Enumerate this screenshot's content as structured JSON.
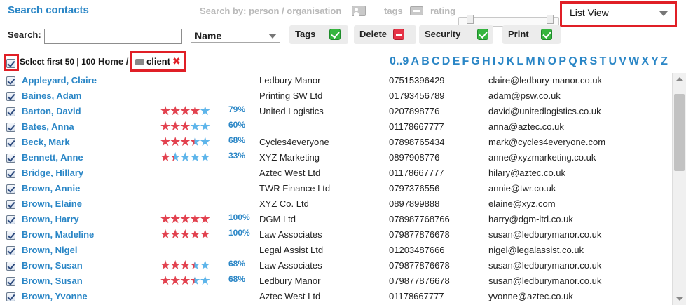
{
  "header": {
    "title": "Search contacts",
    "search_by": "Search by: person / organisation",
    "tags_label": "tags",
    "rating_label": "rating",
    "view_select": "List View"
  },
  "toolbar": {
    "search_label": "Search:",
    "search_value": "",
    "field_select": "Name",
    "tags_label": "Tags",
    "delete_label": "Delete",
    "security_label": "Security",
    "print_label": "Print"
  },
  "selection": {
    "select_first": "Select first 50 | 100",
    "home": "Home /",
    "tag": "client"
  },
  "alphabet": [
    "0..9",
    "A",
    "B",
    "C",
    "D",
    "E",
    "F",
    "G",
    "H",
    "I",
    "J",
    "K",
    "L",
    "M",
    "N",
    "O",
    "P",
    "Q",
    "R",
    "S",
    "T",
    "U",
    "V",
    "W",
    "X",
    "Y",
    "Z"
  ],
  "contacts": [
    {
      "name": "Appleyard, Claire",
      "rating": null,
      "pct": "",
      "company": "Ledbury Manor",
      "phone": "07515396429",
      "email": "claire@ledbury-manor.co.uk"
    },
    {
      "name": "Baines, Adam",
      "rating": null,
      "pct": "",
      "company": "Printing SW Ltd",
      "phone": "01793456789",
      "email": "adam@psw.co.uk"
    },
    {
      "name": "Barton, David",
      "rating": 4,
      "pct": "79%",
      "company": "United Logistics",
      "phone": "0207898776",
      "email": "david@unitedlogistics.co.uk"
    },
    {
      "name": "Bates, Anna",
      "rating": 3,
      "pct": "60%",
      "company": "",
      "phone": "01178667777",
      "email": "anna@aztec.co.uk"
    },
    {
      "name": "Beck, Mark",
      "rating": 3.5,
      "pct": "68%",
      "company": "Cycles4everyone",
      "phone": "07898765434",
      "email": "mark@cycles4everyone.com"
    },
    {
      "name": "Bennett, Anne",
      "rating": 1.5,
      "pct": "33%",
      "company": "XYZ Marketing",
      "phone": "0897908776",
      "email": "anne@xyzmarketing.co.uk"
    },
    {
      "name": "Bridge, Hillary",
      "rating": null,
      "pct": "",
      "company": "Aztec West Ltd",
      "phone": "01178667777",
      "email": "hilary@aztec.co.uk"
    },
    {
      "name": "Brown, Annie",
      "rating": null,
      "pct": "",
      "company": "TWR Finance Ltd",
      "phone": "0797376556",
      "email": "annie@twr.co.uk"
    },
    {
      "name": "Brown, Elaine",
      "rating": null,
      "pct": "",
      "company": "XYZ Co. Ltd",
      "phone": "0897899888",
      "email": "elaine@xyz.com"
    },
    {
      "name": "Brown, Harry",
      "rating": 5,
      "pct": "100%",
      "company": "DGM Ltd",
      "phone": "078987768766",
      "email": "harry@dgm-ltd.co.uk"
    },
    {
      "name": "Brown, Madeline",
      "rating": 5,
      "pct": "100%",
      "company": "Law Associates",
      "phone": "079877876678",
      "email": "susan@ledburymanor.co.uk"
    },
    {
      "name": "Brown, Nigel",
      "rating": null,
      "pct": "",
      "company": "Legal Assist Ltd",
      "phone": "01203487666",
      "email": "nigel@legalassist.co.uk"
    },
    {
      "name": "Brown, Susan",
      "rating": 3.5,
      "pct": "68%",
      "company": "Law Associates",
      "phone": "079877876678",
      "email": "susan@ledburymanor.co.uk"
    },
    {
      "name": "Brown, Susan",
      "rating": 3.5,
      "pct": "68%",
      "company": "Ledbury Manor",
      "phone": "079877876678",
      "email": "susan@ledburymanor.co.uk"
    },
    {
      "name": "Brown, Yvonne",
      "rating": null,
      "pct": "",
      "company": "Aztec West Ltd",
      "phone": "01178667777",
      "email": "yvonne@aztec.co.uk"
    }
  ],
  "colors": {
    "accent": "#2a86c6",
    "highlight": "#e01f26",
    "star_full": "#e2424f",
    "star_empty": "#5eb5ea"
  }
}
